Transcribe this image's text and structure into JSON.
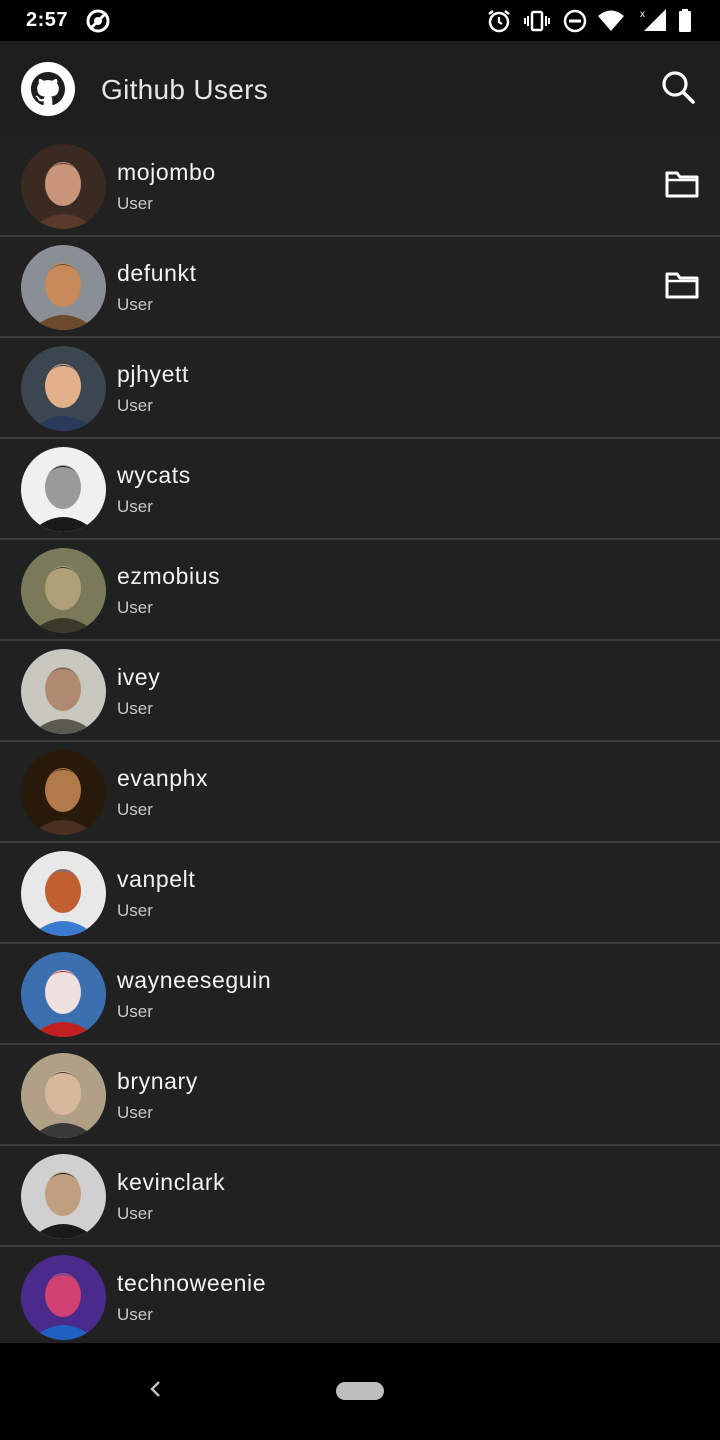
{
  "status_bar": {
    "time": "2:57",
    "icons": [
      "no-disturb-circle-icon",
      "alarm-icon",
      "vibrate-icon",
      "dnd-icon",
      "wifi-icon",
      "signal-icon",
      "battery-icon"
    ]
  },
  "app_bar": {
    "title": "Github Users",
    "logo_icon": "github-octocat-icon",
    "search_icon": "search-icon"
  },
  "users": [
    {
      "login": "mojombo",
      "type": "User",
      "has_repo_icon": true,
      "avatar_colors": [
        "#3a2a22",
        "#c9957a",
        "#5a3a28"
      ]
    },
    {
      "login": "defunkt",
      "type": "User",
      "has_repo_icon": true,
      "avatar_colors": [
        "#8a8f95",
        "#c88a5a",
        "#6a4a2a"
      ]
    },
    {
      "login": "pjhyett",
      "type": "User",
      "has_repo_icon": false,
      "avatar_colors": [
        "#3c4650",
        "#e3b08c",
        "#2a3a5a"
      ]
    },
    {
      "login": "wycats",
      "type": "User",
      "has_repo_icon": false,
      "avatar_colors": [
        "#f0f0f0",
        "#9a9a9a",
        "#1a1a1a"
      ]
    },
    {
      "login": "ezmobius",
      "type": "User",
      "has_repo_icon": false,
      "avatar_colors": [
        "#7a7a5a",
        "#b0a078",
        "#3a3a2a"
      ]
    },
    {
      "login": "ivey",
      "type": "User",
      "has_repo_icon": false,
      "avatar_colors": [
        "#c8c8c0",
        "#b08a70",
        "#5a5a50"
      ]
    },
    {
      "login": "evanphx",
      "type": "User",
      "has_repo_icon": false,
      "avatar_colors": [
        "#2a1a0a",
        "#b07a4a",
        "#4a3020"
      ]
    },
    {
      "login": "vanpelt",
      "type": "User",
      "has_repo_icon": false,
      "avatar_colors": [
        "#e8e8e8",
        "#c06030",
        "#3a7ad0"
      ]
    },
    {
      "login": "wayneeseguin",
      "type": "User",
      "has_repo_icon": false,
      "avatar_colors": [
        "#3a70b0",
        "#f0e0e0",
        "#c02020"
      ]
    },
    {
      "login": "brynary",
      "type": "User",
      "has_repo_icon": false,
      "avatar_colors": [
        "#b0a088",
        "#d8b89a",
        "#3a3a3a"
      ]
    },
    {
      "login": "kevinclark",
      "type": "User",
      "has_repo_icon": false,
      "avatar_colors": [
        "#d0d0d0",
        "#c0a080",
        "#1a1a1a"
      ]
    },
    {
      "login": "technoweenie",
      "type": "User",
      "has_repo_icon": false,
      "avatar_colors": [
        "#4a2a8a",
        "#d04070",
        "#2060c0"
      ]
    }
  ],
  "nav_bar": {
    "back_icon": "back-chevron-icon",
    "home_icon": "home-pill-icon"
  }
}
